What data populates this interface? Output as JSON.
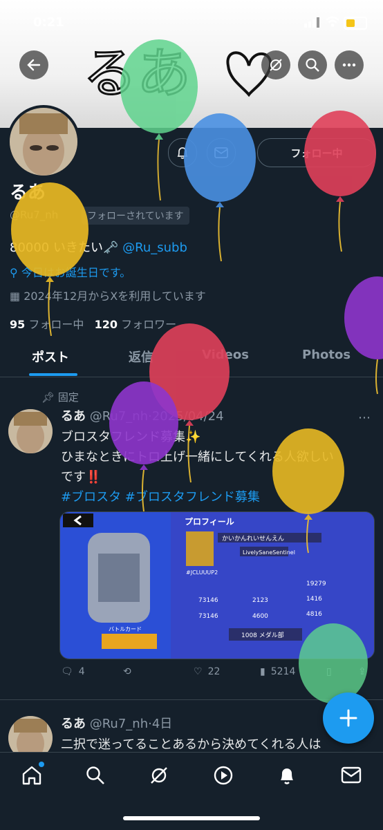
{
  "status_bar": {
    "time": "0:21"
  },
  "header": {
    "scribble_text": "るあ"
  },
  "profile": {
    "follow_button": "フォロー中",
    "name": "るあ",
    "handle": "@Ru7_nh",
    "follows_you": "フォローされています",
    "bio_text": "80000 いきたい🗝️ ",
    "bio_link": "@Ru_subb",
    "birthday": "今日はお誕生日です。",
    "joined": "2024年12月からXを利用しています",
    "following_count": "95",
    "following_label": "フォロー中",
    "followers_count": "120",
    "followers_label": "フォロワー"
  },
  "tabs": [
    {
      "label": "ポスト"
    },
    {
      "label": "返信"
    },
    {
      "label": "Videos"
    },
    {
      "label": "Photos"
    }
  ],
  "posts": [
    {
      "pinned_label": "固定",
      "name": "るあ",
      "handle": "@Ru7_nh",
      "date": "2025/04/24",
      "line1": "ブロスタフレンド募集✨",
      "line2": "ひまなときにトロ上げ一緒にしてくれる人欲しい",
      "line3": "です‼️",
      "hashtags": "#ブロスタ #ブロスタフレンド募集",
      "media": {
        "title": "プロフィール",
        "player_name": "かいかんれいせんえん",
        "tag": "#JCLUUUP2",
        "player_id": "LivelySaneSentinel",
        "trophy": "73146",
        "trophy2": "73146",
        "rank_value": "2123",
        "rank2": "4600",
        "stat1": "19279",
        "stat2": "1416",
        "stat3": "4816",
        "club": "1008 メダル部",
        "battle_card": "バトルカード"
      },
      "replies": "4",
      "likes": "22",
      "views": "5214"
    },
    {
      "name": "るあ",
      "handle": "@Ru7_nh",
      "date": "4日",
      "line1": "二択で迷ってることあるから決めてくれる人は"
    }
  ],
  "colors": {
    "accent": "#1d9bf0",
    "bg": "#15202b",
    "muted": "#8b98a5"
  }
}
